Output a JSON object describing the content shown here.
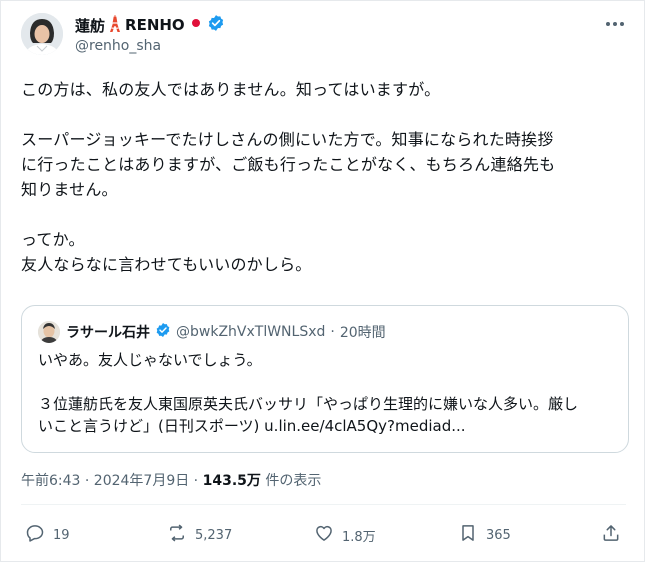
{
  "author": {
    "name": "蓮舫",
    "suffix": "RENHO",
    "handle": "@renho_sha"
  },
  "tweet": {
    "text": "この方は、私の友人ではありません。知ってはいますが。\n\nスーパージョッキーでたけしさんの側にいた方で。知事になられた時挨拶\nに行ったことはありますが、ご飯も行ったことがなく、もちろん連絡先も\n知りません。\n\nってか。\n友人ならなに言わせてもいいのかしら。"
  },
  "quote": {
    "name": "ラサール石井",
    "handle": "@bwkZhVxTlWNLSxd",
    "time": "20時間",
    "text": "いやあ。友人じゃないでしょう。\n\n３位蓮舫氏を友人東国原英夫氏バッサリ「やっぱり生理的に嫌いな人多い。厳し\nいこと言うけど」(日刊スポーツ) u.lin.ee/4clA5Qy?mediad..."
  },
  "timestamp": {
    "datetime": "午前6:43 · 2024年7月9日 · ",
    "views": "143.5万",
    "views_label": " 件の表示"
  },
  "actions": {
    "replies": "19",
    "reposts": "5,237",
    "likes": "1.8万",
    "bookmarks": "365"
  },
  "colors": {
    "verified": "#1d9bf0",
    "muted": "#536471",
    "border": "#cfd9de",
    "flag_red": "#e0103a"
  },
  "icons": [
    "tokyo-tower-emoji",
    "japan-flag-emoji",
    "verified-badge-icon",
    "more-options-icon",
    "reply-icon",
    "repost-icon",
    "like-icon",
    "bookmark-icon",
    "share-icon"
  ]
}
